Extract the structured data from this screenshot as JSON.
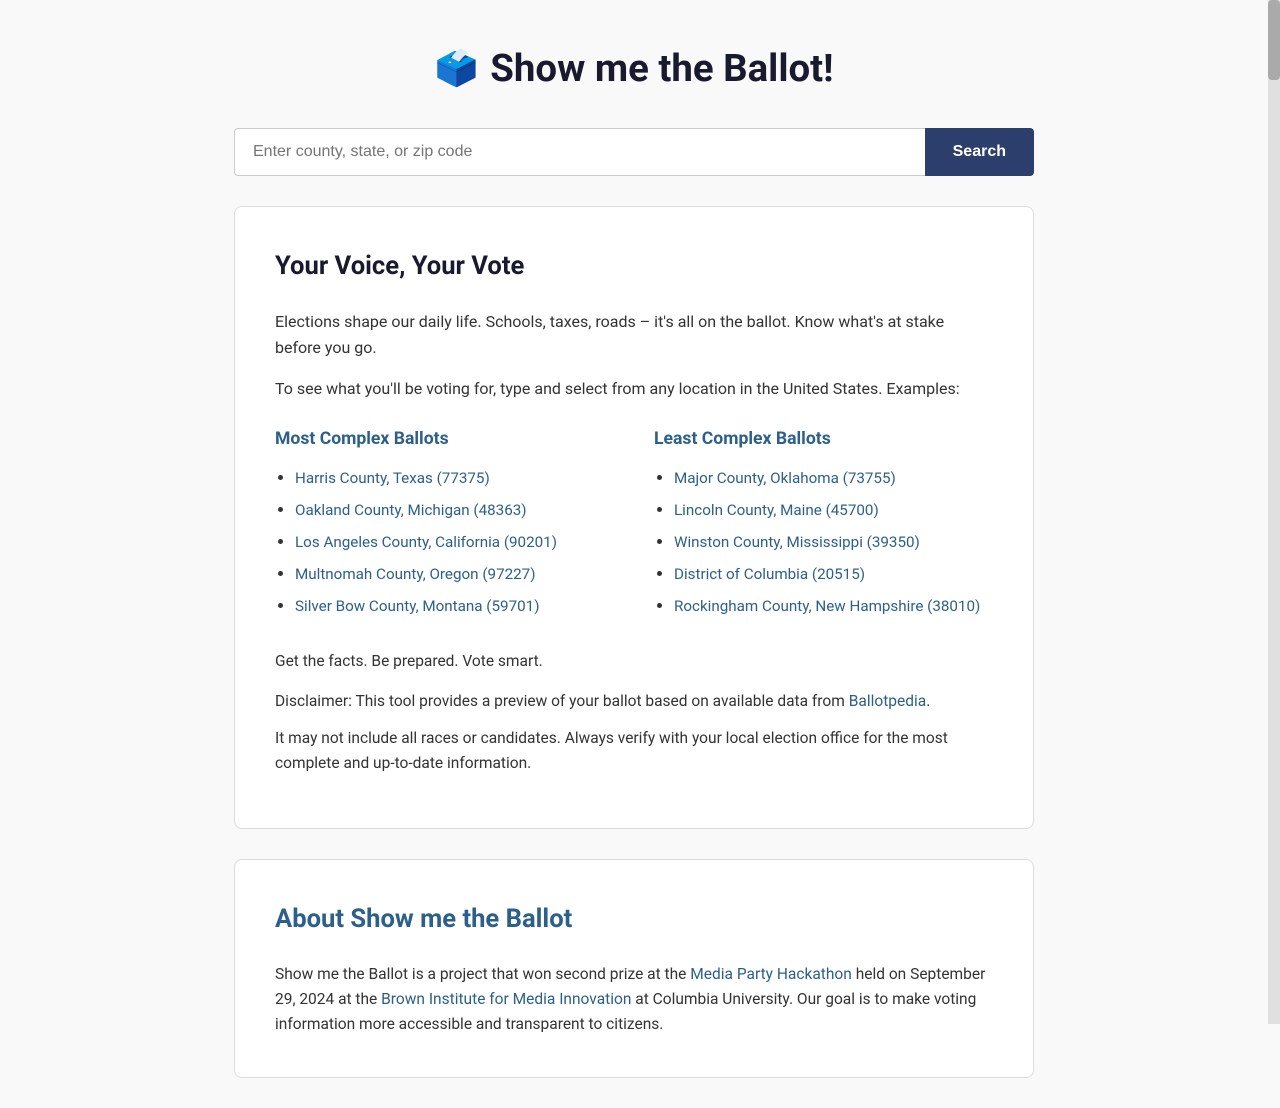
{
  "page": {
    "title": "Show me the Ballot!",
    "ballot_emoji": "🗳️"
  },
  "search": {
    "placeholder": "Enter county, state, or zip code",
    "button_label": "Search"
  },
  "main_card": {
    "title": "Your Voice, Your Vote",
    "intro_paragraph1": "Elections shape our daily life. Schools, taxes, roads – it's all on the ballot. Know what's at stake before you go.",
    "intro_paragraph2": "To see what you'll be voting for, type and select from any location in the United States. Examples:",
    "most_complex_title": "Most Complex Ballots",
    "most_complex_items": [
      {
        "label": "Harris County, Texas (77375)",
        "href": "#"
      },
      {
        "label": "Oakland County, Michigan (48363)",
        "href": "#"
      },
      {
        "label": "Los Angeles County, California (90201)",
        "href": "#"
      },
      {
        "label": "Multnomah County, Oregon (97227)",
        "href": "#"
      },
      {
        "label": "Silver Bow County, Montana (59701)",
        "href": "#"
      }
    ],
    "least_complex_title": "Least Complex Ballots",
    "least_complex_items": [
      {
        "label": "Major County, Oklahoma (73755)",
        "href": "#"
      },
      {
        "label": "Lincoln County, Maine (45700)",
        "href": "#"
      },
      {
        "label": "Winston County, Mississippi (39350)",
        "href": "#"
      },
      {
        "label": "District of Columbia (20515)",
        "href": "#"
      },
      {
        "label": "Rockingham County, New Hampshire (38010)",
        "href": "#"
      }
    ],
    "tagline": "Get the facts. Be prepared. Vote smart.",
    "disclaimer_text": "Disclaimer: This tool provides a preview of your ballot based on available data from ",
    "disclaimer_link_label": "Ballotpedia",
    "disclaimer_link_href": "#",
    "disclaimer_suffix": ".",
    "disclaimer2": "It may not include all races or candidates. Always verify with your local election office for the most complete and up-to-date information."
  },
  "about_card": {
    "title": "About Show me the Ballot",
    "text_before_link1": "Show me the Ballot is a project that won second prize at the ",
    "link1_label": "Media Party Hackathon",
    "link1_href": "#",
    "text_between": " held on September 29, 2024 at the ",
    "link2_label": "Brown Institute for Media Innovation",
    "link2_href": "#",
    "text_after": " at Columbia University. Our goal is to make voting information more accessible and transparent to citizens."
  }
}
